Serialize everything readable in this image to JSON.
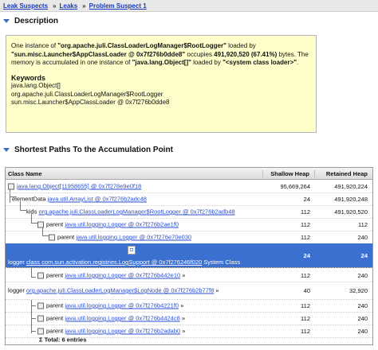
{
  "breadcrumb": {
    "items": [
      "Leak Suspects",
      "Leaks",
      "Problem Suspect 1"
    ],
    "separator": "»"
  },
  "description": {
    "title": "Description",
    "p1": "One instance of ",
    "p2": "\"org.apache.juli.ClassLoaderLogManager$RootLogger\"",
    "p3": " loaded by ",
    "p4": "\"sun.misc.Launcher$AppClassLoader @ 0x7f276b0dde8\"",
    "p5": " occupies ",
    "p6": "491,920,520 (67.41%)",
    "p7": " bytes. The memory is accumulated in one instance of ",
    "p8": "\"java.lang.Object[]\"",
    "p9": " loaded by ",
    "p10": "\"<system class loader>\"",
    "p11": ".",
    "keywords_title": "Keywords",
    "keywords": [
      "java.lang.Object[]",
      "org.apache.juli.ClassLoaderLogManager$RootLogger",
      "sun.misc.Launcher$AppClassLoader @ 0x7f276b0dde8"
    ]
  },
  "paths": {
    "title": "Shortest Paths To the Accumulation Point",
    "columns": {
      "name": "Class Name",
      "shallow": "Shallow Heap",
      "retained": "Retained Heap"
    },
    "rows": [
      {
        "prefix": "",
        "link": "java.lang.Object[11958655] @ 0x7f278e9e0f18",
        "suffix": "",
        "shallow": "95,669,264",
        "retained": "491,920,224"
      },
      {
        "prefix": "elementData",
        "link": "java.util.ArrayList @ 0x7f276b2adc48",
        "suffix": "",
        "shallow": "24",
        "retained": "491,920,248"
      },
      {
        "prefix": "kids",
        "link": "org.apache.juli.ClassLoaderLogManager$RootLogger @ 0x7f276b2adb48",
        "suffix": "",
        "shallow": "112",
        "retained": "491,920,520"
      },
      {
        "prefix": "parent",
        "link": "java.util.logging.Logger @ 0x7f276b2ae1f0",
        "suffix": "",
        "shallow": "112",
        "retained": "112"
      },
      {
        "prefix": "parent",
        "link": "java.util.logging.Logger @ 0x7f276e70e030",
        "suffix": "",
        "shallow": "112",
        "retained": "240"
      },
      {
        "prefix": "logger",
        "link": "class com.sun.activation.registries.LogSupport @ 0x7f276246f020",
        "suffix": " System Class",
        "shallow": "24",
        "retained": "24"
      },
      {
        "prefix": "parent",
        "link": "java.util.logging.Logger @ 0x7f276b442e10",
        "suffix": " »",
        "shallow": "112",
        "retained": "240"
      },
      {
        "prefix": "logger",
        "link": "org.apache.juli.ClassLoaderLogManager$LogNode @ 0x7f276b2b77f8",
        "suffix": " »",
        "shallow": "40",
        "retained": "32,920"
      },
      {
        "prefix": "parent",
        "link": "java.util.logging.Logger @ 0x7f276b4221f0",
        "suffix": " »",
        "shallow": "112",
        "retained": "240"
      },
      {
        "prefix": "parent",
        "link": "java.util.logging.Logger @ 0x7f276b4424c8",
        "suffix": " »",
        "shallow": "112",
        "retained": "240"
      },
      {
        "prefix": "parent",
        "link": "java.util.logging.Logger @ 0x7f276b2adab0",
        "suffix": " »",
        "shallow": "112",
        "retained": "240"
      }
    ],
    "total": "Total: 6 entries",
    "total_symbol": "Σ"
  },
  "colors": {
    "link": "#2b4fcf",
    "selected_row": "#3b6fd0",
    "description_bg": "#ffffcc",
    "section_arrow": "#3c6bbd"
  }
}
